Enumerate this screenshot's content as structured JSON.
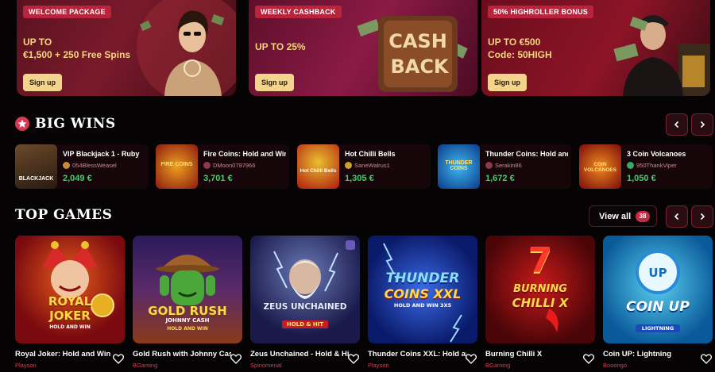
{
  "promos": [
    {
      "badge": "WELCOME PACKAGE",
      "line1": "UP TO",
      "line2": "€1,500 + 250 Free Spins",
      "button": "Sign up"
    },
    {
      "badge": "WEEKLY CASHBACK",
      "line1": "UP TO 25%",
      "line2": "",
      "button": "Sign up",
      "art_text_1": "CASH",
      "art_text_2": "BACK"
    },
    {
      "badge": "50% HIGHROLLER BONUS",
      "line1": "UP TO €500",
      "line2": "Code: 50HIGH",
      "button": "Sign up"
    }
  ],
  "big_wins": {
    "title": "BIG WINS",
    "items": [
      {
        "game": "VIP Blackjack 1 - Ruby",
        "user": "054BlessWeasel",
        "amount": "2,049 €",
        "thumb_text": "BLACKJACK"
      },
      {
        "game": "Fire Coins: Hold and Win",
        "user": "DMoon0797966",
        "amount": "3,701 €",
        "thumb_text": "FIRE COINS"
      },
      {
        "game": "Hot Chilli Bells",
        "user": "SaneWalrus1",
        "amount": "1,305 €",
        "thumb_text": "Hot Chilli Bells"
      },
      {
        "game": "Thunder Coins: Hold and Win",
        "user": "Serakin86",
        "amount": "1,672 €",
        "thumb_text": "THUNDER COINS"
      },
      {
        "game": "3 Coin Volcanoes",
        "user": "950ThankViper",
        "amount": "1,050 €",
        "thumb_text": "COIN VOLCANOES"
      }
    ]
  },
  "top_games": {
    "title": "TOP GAMES",
    "view_all": "View all",
    "count": "38",
    "items": [
      {
        "name": "Royal Joker: Hold and Win",
        "provider": "Playson",
        "logo_1": "ROYAL",
        "logo_2": "JOKER",
        "logo_3": "HOLD AND WIN"
      },
      {
        "name": "Gold Rush with Johnny Cash",
        "provider": "BGaming",
        "logo_1": "GOLD RUSH",
        "logo_2": "JOHNNY CASH",
        "logo_3": "HOLD AND WIN"
      },
      {
        "name": "Zeus Unchained - Hold & Hit",
        "provider": "Spinomenal",
        "logo_1": "ZEUS UNCHAINED",
        "logo_2": "HOLD & HIT",
        "logo_3": ""
      },
      {
        "name": "Thunder Coins XXL: Hold and Win",
        "provider": "Playson",
        "logo_1": "THUNDER",
        "logo_2": "COINS XXL",
        "logo_3": "HOLD AND WIN 3X5"
      },
      {
        "name": "Burning Chilli X",
        "provider": "BGaming",
        "logo_1": "7",
        "logo_2": "BURNING",
        "logo_3": "CHILLI X"
      },
      {
        "name": "Coin UP: Lightning",
        "provider": "Booongo",
        "logo_1": "UP",
        "logo_2": "COIN UP",
        "logo_3": "LIGHTNING"
      }
    ]
  },
  "colors": {
    "accent": "#c62a44",
    "win_amount": "#3fd36b",
    "promo_text": "#f4d77a"
  }
}
